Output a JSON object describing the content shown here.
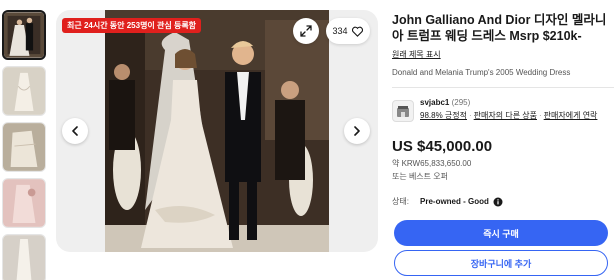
{
  "gallery": {
    "promo_badge": "최근 24시간 동안 253명이 관심 등록함",
    "watch_count": "334",
    "thumbnails": [
      {
        "icon": "wedding-photo-thumbnail"
      },
      {
        "icon": "dress-photo-thumbnail"
      },
      {
        "icon": "dress-detail-thumbnail"
      },
      {
        "icon": "dress-pink-thumbnail"
      },
      {
        "icon": "dress-side-thumbnail"
      }
    ]
  },
  "listing": {
    "title": "John Galliano And Dior 디자인 멜라니아 트럼프 웨딩 드레스 Msrp $210k-",
    "translate_link": "원래 제목 표시",
    "subtitle": "Donald and Melania Trump's 2005 Wedding Dress"
  },
  "seller": {
    "name": "svjabc1",
    "feedback_count": "(295)",
    "positive": "98.8% 긍정적",
    "link_other_items": "판매자의 다른 상품",
    "link_contact": "판매자에게 연락"
  },
  "price": {
    "main": "US $45,000.00",
    "converted": "약 KRW65,833,650.00",
    "note": "또는 베스트 오퍼"
  },
  "condition": {
    "label": "상태:",
    "value": "Pre-owned - Good"
  },
  "actions": {
    "buy_now": "즉시 구매",
    "add_to_cart": "장바구니에 추가"
  },
  "colors": {
    "primary_blue": "#3665f3",
    "badge_red": "#e0201d"
  }
}
